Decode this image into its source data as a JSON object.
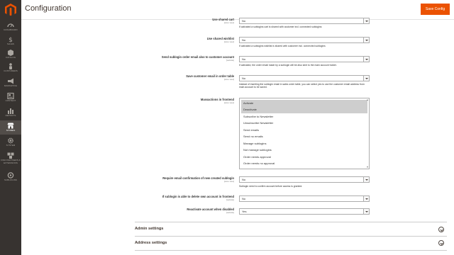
{
  "header": {
    "title": "Configuration",
    "save_label": "Save Config"
  },
  "sidebar": {
    "items": [
      {
        "label": "Dashboard",
        "icon": "dashboard-icon"
      },
      {
        "label": "Sales",
        "icon": "dollar-icon"
      },
      {
        "label": "Catalog",
        "icon": "cube-icon"
      },
      {
        "label": "Customers",
        "icon": "person-icon"
      },
      {
        "label": "Marketing",
        "icon": "megaphone-icon"
      },
      {
        "label": "Content",
        "icon": "layout-icon"
      },
      {
        "label": "Reports",
        "icon": "bar-chart-icon"
      },
      {
        "label": "Stores",
        "icon": "store-icon",
        "active": true
      },
      {
        "label": "System",
        "icon": "gear-icon"
      },
      {
        "label": "Find Partners & Extensions",
        "icon": "extensions-icon"
      },
      {
        "label": "Sublogins",
        "icon": "sublogins-icon"
      }
    ]
  },
  "fields": [
    {
      "label": "Use shared cart",
      "scope": "[store view]",
      "value": "No",
      "note": "If activated a sublogins cart is shared with customer incl. connected sublogins"
    },
    {
      "label": "Use shared wishlist",
      "scope": "[store view]",
      "value": "No",
      "note": "If activated a sublogins wishlist is shared with customer incl. connected sublogins"
    },
    {
      "label": "Send sublogin order email also to customer account",
      "scope": "[website]",
      "value": "No",
      "note": "If activated, the order email made by a sublogin will be also sent to the main account holder."
    },
    {
      "label": "Save customer email in order table",
      "scope": "[store view]",
      "value": "No",
      "note": "Instead of inserting the sublogin email in sales order table, you can select yes to use the customer email address from main account to be saved."
    }
  ],
  "massactions": {
    "label": "Massactions in frontend",
    "scope": "[store view]",
    "options": [
      {
        "label": "Activate",
        "selected": true
      },
      {
        "label": "Deactivate",
        "selected": true
      },
      {
        "label": "Subscribe to Newsletter",
        "selected": false
      },
      {
        "label": "Unsubscribe Newsletter",
        "selected": false
      },
      {
        "label": "Send emails",
        "selected": false
      },
      {
        "label": "Send no emails",
        "selected": false
      },
      {
        "label": "Manage sublogins",
        "selected": false
      },
      {
        "label": "Not manage sublogins",
        "selected": false
      },
      {
        "label": "Order needs approval",
        "selected": false
      },
      {
        "label": "Order needs no approval",
        "selected": false
      }
    ]
  },
  "fields2": [
    {
      "label": "Require email confirmation of new created sublogin",
      "scope": "[store view]",
      "value": "No",
      "note": "Sublogin need to confirm account before access is granted."
    },
    {
      "label": "If sublogin is able to delete own account in frontend",
      "scope": "[website]",
      "value": "No",
      "note": ""
    },
    {
      "label": "Reactivate account when disabled",
      "scope": "[website]",
      "value": "Yes",
      "note": ""
    }
  ],
  "sections": [
    {
      "title": "Admin settings"
    },
    {
      "title": "Address settings"
    }
  ],
  "colors": {
    "accent": "#eb5202",
    "sidebar_bg": "#373330"
  }
}
